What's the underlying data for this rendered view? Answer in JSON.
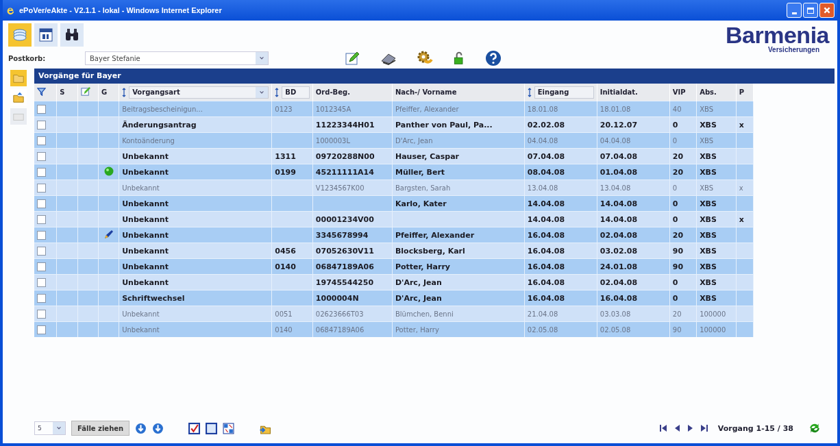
{
  "window": {
    "title": "ePoVer/eAkte - V2.1.1 - lokal - Windows Internet Explorer"
  },
  "logo": {
    "name": "Barmenia",
    "subtitle": "Versicherungen"
  },
  "postkorb": {
    "label": "Postkorb:",
    "value": "Bayer Stefanie"
  },
  "panel_title": "Vorgänge für Bayer",
  "columns": [
    {
      "label": "S",
      "kind": "plain"
    },
    {
      "label": "G",
      "kind": "plain"
    },
    {
      "label": "Vorgangsart",
      "kind": "select"
    },
    {
      "label": "BD",
      "kind": "sort"
    },
    {
      "label": "Ord-Beg.",
      "kind": "plain"
    },
    {
      "label": "Nach-/ Vorname",
      "kind": "plain"
    },
    {
      "label": "Eingang",
      "kind": "sort"
    },
    {
      "label": "Initialdat.",
      "kind": "plain"
    },
    {
      "label": "VIP",
      "kind": "plain"
    },
    {
      "label": "Abs.",
      "kind": "plain"
    },
    {
      "label": "P",
      "kind": "plain"
    }
  ],
  "rows": [
    {
      "checked": false,
      "unread": false,
      "kind": "plain",
      "cells": [
        "Beitragsbescheinigun...",
        "0123",
        "1012345A",
        "Pfeiffer, Alexander",
        "18.01.08",
        "18.01.08",
        "40",
        "XBS",
        ""
      ]
    },
    {
      "checked": false,
      "unread": true,
      "kind": "plain",
      "cells": [
        "Änderungsantrag",
        "",
        "11223344H01",
        "Panther von Paul, Pa...",
        "02.02.08",
        "20.12.07",
        "0",
        "XBS",
        "x"
      ]
    },
    {
      "checked": false,
      "unread": false,
      "kind": "plain",
      "cells": [
        "Kontoänderung",
        "",
        "1000003L",
        "D'Arc, Jean",
        "04.04.08",
        "04.04.08",
        "0",
        "XBS",
        ""
      ]
    },
    {
      "checked": false,
      "unread": true,
      "kind": "plain",
      "cells": [
        "Unbekannt",
        "1311",
        "09720288N00",
        "Hauser, Caspar",
        "07.04.08",
        "07.04.08",
        "20",
        "XBS",
        ""
      ]
    },
    {
      "checked": false,
      "unread": true,
      "kind": "dot",
      "cells": [
        "Unbekannt",
        "0199",
        "45211111A14",
        "Müller, Bert",
        "08.04.08",
        "01.04.08",
        "20",
        "XBS",
        ""
      ]
    },
    {
      "checked": false,
      "unread": false,
      "kind": "plain",
      "cells": [
        "Unbekannt",
        "",
        "V1234567K00",
        "Bargsten, Sarah",
        "13.04.08",
        "13.04.08",
        "0",
        "XBS",
        "x"
      ]
    },
    {
      "checked": false,
      "unread": true,
      "kind": "plain",
      "cells": [
        "Unbekannt",
        "",
        "",
        "Karlo, Kater",
        "14.04.08",
        "14.04.08",
        "0",
        "XBS",
        ""
      ]
    },
    {
      "checked": false,
      "unread": true,
      "kind": "plain",
      "cells": [
        "Unbekannt",
        "",
        "00001234V00",
        "",
        "14.04.08",
        "14.04.08",
        "0",
        "XBS",
        "x"
      ]
    },
    {
      "checked": false,
      "unread": true,
      "kind": "pen",
      "cells": [
        "Unbekannt",
        "",
        "3345678994",
        "Pfeiffer, Alexander",
        "16.04.08",
        "02.04.08",
        "20",
        "XBS",
        ""
      ]
    },
    {
      "checked": false,
      "unread": true,
      "kind": "plain",
      "cells": [
        "Unbekannt",
        "0456",
        "07052630V11",
        "Blocksberg, Karl",
        "16.04.08",
        "03.02.08",
        "90",
        "XBS",
        ""
      ]
    },
    {
      "checked": false,
      "unread": true,
      "kind": "plain",
      "cells": [
        "Unbekannt",
        "0140",
        "06847189A06",
        "Potter, Harry",
        "16.04.08",
        "24.01.08",
        "90",
        "XBS",
        ""
      ]
    },
    {
      "checked": false,
      "unread": true,
      "kind": "plain",
      "cells": [
        "Unbekannt",
        "",
        "19745544250",
        "D'Arc, Jean",
        "16.04.08",
        "02.04.08",
        "0",
        "XBS",
        ""
      ]
    },
    {
      "checked": false,
      "unread": true,
      "kind": "plain",
      "cells": [
        "Schriftwechsel",
        "",
        "1000004N",
        "D'Arc, Jean",
        "16.04.08",
        "16.04.08",
        "0",
        "XBS",
        ""
      ]
    },
    {
      "checked": false,
      "unread": false,
      "kind": "plain",
      "cells": [
        "Unbekannt",
        "0051",
        "02623666T03",
        "Blümchen, Benni",
        "21.04.08",
        "03.03.08",
        "20",
        "100000",
        ""
      ]
    },
    {
      "checked": false,
      "unread": false,
      "kind": "plain",
      "cells": [
        "Unbekannt",
        "0140",
        "06847189A06",
        "Potter, Harry",
        "02.05.08",
        "02.05.08",
        "90",
        "100000",
        ""
      ]
    }
  ],
  "footer": {
    "page_size": "5",
    "pull_button": "Fälle ziehen",
    "pager_text": "Vorgang 1-15 / 38"
  }
}
